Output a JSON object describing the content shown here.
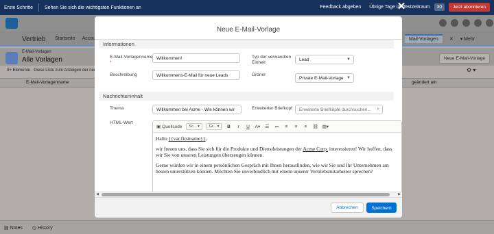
{
  "topbar": {
    "first_steps": "Erste Schritte",
    "functions": "Sehen Sie sich die wichtigsten Funktionen an",
    "feedback": "Feedback abgeben",
    "trial": "Übrige Tage im Testzeitraum",
    "days": "30",
    "subscribe": "Jetzt abonnieren"
  },
  "app": {
    "name": "Vertrieb",
    "nav": [
      "Startseite",
      "Accou"
    ],
    "active_tab": "Mail-Vorlagen",
    "more": "Mehr"
  },
  "list": {
    "subtitle": "E-Mail-Vorlagen",
    "title": "Alle Vorlagen",
    "new_button": "Neue E-Mail-Vorlage",
    "info": "0+ Elemente · Diese Liste zum Anzeigen der neue",
    "col_name": "E-Mail-Vorlagenname",
    "col_date": "geändert am"
  },
  "bottombar": {
    "notes": "Notes",
    "history": "History"
  },
  "modal": {
    "title": "Neue E-Mail-Vorlage",
    "section_info": "Informationen",
    "label_name": "E-Mail-Vorlagenname",
    "value_name": "Willkommen!",
    "label_desc": "Beschreibung",
    "value_desc": "Willkommens-E-Mail für neue Leads",
    "label_entity": "Typ der verwandten Einheit",
    "value_entity": "Lead",
    "label_folder": "Ordner",
    "value_folder": "Private E-Mail-Vorlage",
    "section_msg": "Nachrichteninhalt",
    "label_subject": "Thema",
    "value_subject": "Willkommen bei Acme - Wie können wir",
    "label_letterhead": "Erweiterter Briefkopf",
    "placeholder_letterhead": "Erweiterte Briefköpfe durchsuchen...",
    "label_html": "HTML-Wert",
    "toolbar": {
      "source": "Quellcode",
      "font": "Sc...",
      "size": "Gr..."
    },
    "body": {
      "greeting": "Hallo",
      "merge": "{{var.firstname}}",
      "greeting_end": ",",
      "p1_a": "wir freuen uns, dass Sie sich für die Produkte und Dienstleistungen der",
      "p1_company": "Acme Corp.",
      "p1_b": "interessieren! Wir hoffen, dass wir Sie von unseren Leistungen überzeugen können.",
      "p2": "Gerne würden wir in einem persönlichen Gespräch mit Ihnen herausfinden, wie wir Sie und Ihr Unternehmen am besten unterstützen können. Möchten Sie unverbindlich mit einem unserer Vertriebsmitarbeiter sprechen?"
    },
    "cancel": "Abbrechen",
    "save": "Speichern"
  }
}
